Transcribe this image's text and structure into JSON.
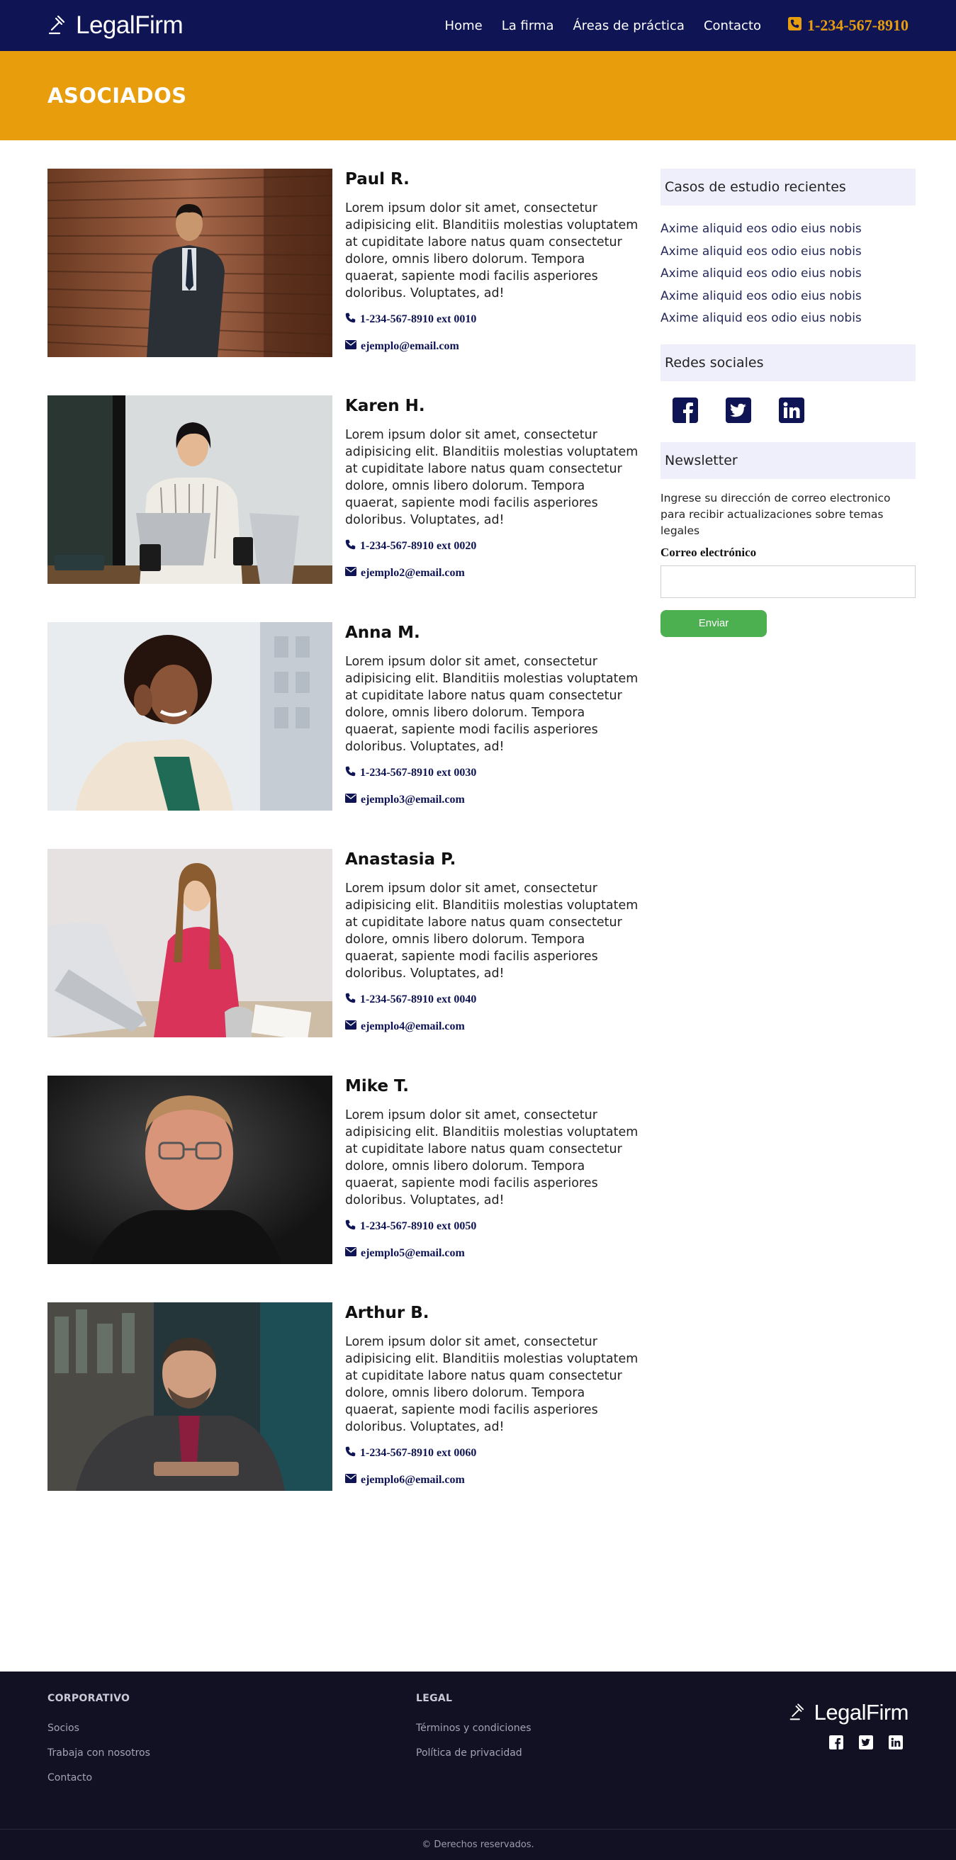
{
  "header": {
    "logo": "LegalFirm",
    "nav": [
      "Home",
      "La firma",
      "Áreas de práctica",
      "Contacto"
    ],
    "phone": "1-234-567-8910"
  },
  "banner": {
    "title": "ASOCIADOS"
  },
  "associates": [
    {
      "name": "Paul R.",
      "bio": "Lorem ipsum dolor sit amet, consectetur adipisicing elit. Blanditiis molestias voluptatem at cupiditate labore natus quam consectetur dolore, omnis libero dolorum. Tempora quaerat, sapiente modi facilis asperiores doloribus. Voluptates, ad!",
      "phone": "1-234-567-8910 ext 0010",
      "email": "ejemplo@email.com"
    },
    {
      "name": "Karen H.",
      "bio": "Lorem ipsum dolor sit amet, consectetur adipisicing elit. Blanditiis molestias voluptatem at cupiditate labore natus quam consectetur dolore, omnis libero dolorum. Tempora quaerat, sapiente modi facilis asperiores doloribus. Voluptates, ad!",
      "phone": "1-234-567-8910 ext 0020",
      "email": "ejemplo2@email.com"
    },
    {
      "name": "Anna M.",
      "bio": "Lorem ipsum dolor sit amet, consectetur adipisicing elit. Blanditiis molestias voluptatem at cupiditate labore natus quam consectetur dolore, omnis libero dolorum. Tempora quaerat, sapiente modi facilis asperiores doloribus. Voluptates, ad!",
      "phone": "1-234-567-8910 ext 0030",
      "email": "ejemplo3@email.com"
    },
    {
      "name": "Anastasia P.",
      "bio": "Lorem ipsum dolor sit amet, consectetur adipisicing elit. Blanditiis molestias voluptatem at cupiditate labore natus quam consectetur dolore, omnis libero dolorum. Tempora quaerat, sapiente modi facilis asperiores doloribus. Voluptates, ad!",
      "phone": "1-234-567-8910 ext 0040",
      "email": "ejemplo4@email.com"
    },
    {
      "name": "Mike T.",
      "bio": "Lorem ipsum dolor sit amet, consectetur adipisicing elit. Blanditiis molestias voluptatem at cupiditate labore natus quam consectetur dolore, omnis libero dolorum. Tempora quaerat, sapiente modi facilis asperiores doloribus. Voluptates, ad!",
      "phone": "1-234-567-8910 ext 0050",
      "email": "ejemplo5@email.com"
    },
    {
      "name": "Arthur B.",
      "bio": "Lorem ipsum dolor sit amet, consectetur adipisicing elit. Blanditiis molestias voluptatem at cupiditate labore natus quam consectetur dolore, omnis libero dolorum. Tempora quaerat, sapiente modi facilis asperiores doloribus. Voluptates, ad!",
      "phone": "1-234-567-8910 ext 0060",
      "email": "ejemplo6@email.com"
    }
  ],
  "sidebar": {
    "cases_title": "Casos de estudio recientes",
    "cases": [
      "Axime aliquid eos odio eius nobis",
      "Axime aliquid eos odio eius nobis",
      "Axime aliquid eos odio eius nobis",
      "Axime aliquid eos odio eius nobis",
      "Axime aliquid eos odio eius nobis"
    ],
    "social_title": "Redes sociales",
    "social_icons": [
      "facebook-icon",
      "twitter-icon",
      "linkedin-icon"
    ],
    "newsletter_title": "Newsletter",
    "newsletter_text": "Ingrese su dirección de correo electronico para recibir actualizaciones sobre temas legales",
    "email_label": "Correo electrónico",
    "email_value": "",
    "submit_label": "Enviar"
  },
  "footer": {
    "corporate_title": "CORPORATIVO",
    "corporate_links": [
      "Socios",
      "Trabaja con nosotros",
      "Contacto"
    ],
    "legal_title": "LEGAL",
    "legal_links": [
      "Términos y condiciones",
      "Política de privacidad"
    ],
    "logo": "LegalFirm",
    "copyright": "© Derechos reservados."
  },
  "colors": {
    "navy": "#0e1454",
    "accent": "#e89d0d",
    "button": "#4caf50",
    "footer": "#121124"
  }
}
